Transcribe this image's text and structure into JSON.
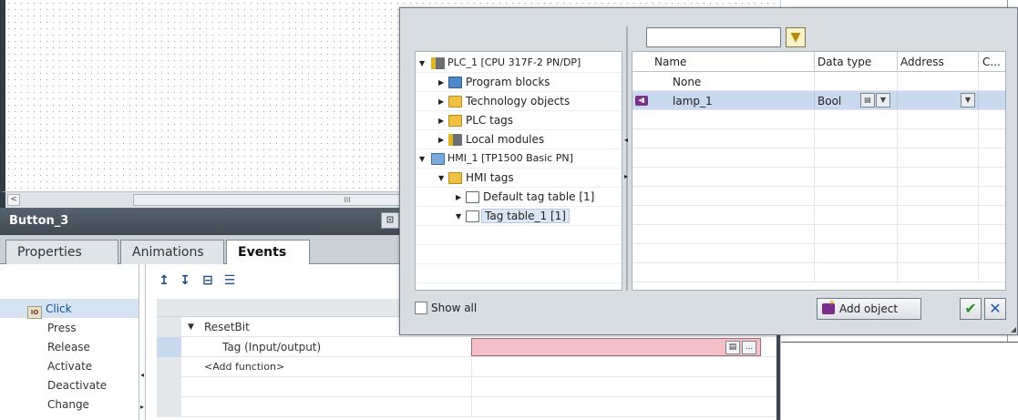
{
  "canvas": {
    "scroll_thumb_glyph": "III",
    "scroll_left_glyph": "<"
  },
  "inspector": {
    "title": "Button_3",
    "window_icon_glyph": "⊡",
    "tabs": [
      "Properties",
      "Animations",
      "Events"
    ],
    "active_tab": "Events",
    "events": [
      "Click",
      "Press",
      "Release",
      "Activate",
      "Deactivate",
      "Change"
    ],
    "selected_event": "Click",
    "event_icon_text": "IO",
    "toolbar_glyphs": [
      "↥",
      "↧",
      "⊟",
      "☰"
    ],
    "function_list": {
      "function_name": "ResetBit",
      "param_label": "Tag (Input/output)",
      "add_function": "<Add function>",
      "field_btn_1": "▤",
      "field_btn_2": "..."
    }
  },
  "popup": {
    "filter_value": "",
    "filter_icon": "funnel-icon",
    "tree": [
      {
        "label": "PLC_1 [CPU 317F-2 PN/DP]",
        "expanded": true,
        "level": 0,
        "icon": "plc-icon"
      },
      {
        "label": "Program blocks",
        "expanded": false,
        "level": 1,
        "icon": "program-blocks-icon"
      },
      {
        "label": "Technology objects",
        "expanded": false,
        "level": 1,
        "icon": "technology-objects-icon"
      },
      {
        "label": "PLC tags",
        "expanded": false,
        "level": 1,
        "icon": "folder-icon"
      },
      {
        "label": "Local modules",
        "expanded": false,
        "level": 1,
        "icon": "module-icon"
      },
      {
        "label": "HMI_1 [TP1500 Basic PN]",
        "expanded": true,
        "level": 0,
        "icon": "hmi-icon"
      },
      {
        "label": "HMI tags",
        "expanded": true,
        "level": 1,
        "icon": "folder-icon"
      },
      {
        "label": "Default tag table [1]",
        "expanded": false,
        "level": 2,
        "icon": "tag-table-icon"
      },
      {
        "label": "Tag table_1 [1]",
        "expanded": true,
        "level": 2,
        "icon": "tag-table-icon",
        "selected": true
      }
    ],
    "grid": {
      "headers": [
        "Name",
        "Data type",
        "Address",
        "C..."
      ],
      "rows": [
        {
          "name": "None",
          "data_type": "",
          "address": ""
        },
        {
          "name": "lamp_1",
          "data_type": "Bool",
          "address": "",
          "selected": true,
          "icon_text": "◂▮"
        }
      ]
    },
    "footer": {
      "show_all_label": "Show all",
      "add_object_label": "Add object",
      "ok_glyph": "✔",
      "cancel_glyph": "✕"
    }
  }
}
